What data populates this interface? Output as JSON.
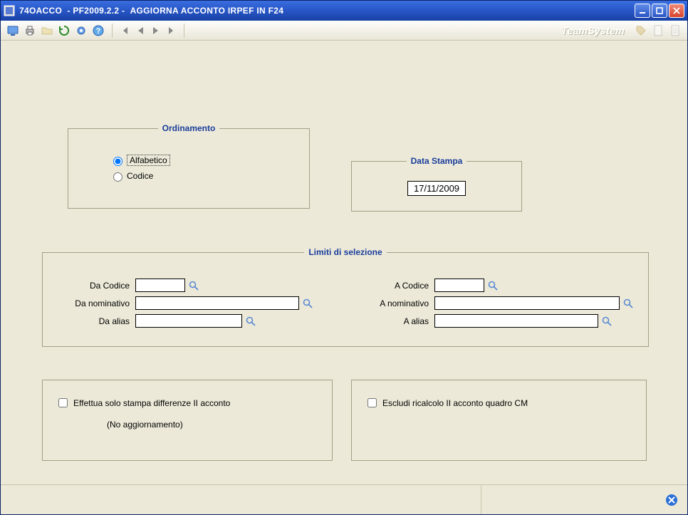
{
  "titlebar": {
    "app_code": "74OACCO",
    "version": "PF2009.2.2",
    "subtitle": "AGGIORNA ACCONTO IRPEF IN F24"
  },
  "brand": "TeamSystem",
  "groups": {
    "ordinamento_legend": "Ordinamento",
    "datastampa_legend": "Data Stampa",
    "limiti_legend": "Limiti di selezione"
  },
  "ordinamento": {
    "opt_alpha": "Alfabetico",
    "opt_code": "Codice",
    "selected": "alpha"
  },
  "stampa": {
    "date": "17/11/2009"
  },
  "limiti": {
    "da_codice_label": "Da Codice",
    "da_nominativo_label": "Da nominativo",
    "da_alias_label": "Da alias",
    "a_codice_label": "A Codice",
    "a_nominativo_label": "A nominativo",
    "a_alias_label": "A alias",
    "da_codice": "",
    "da_nominativo": "",
    "da_alias": "",
    "a_codice": "",
    "a_nominativo": "",
    "a_alias": ""
  },
  "options": {
    "solo_stampa_label": "Effettua solo stampa differenze II acconto",
    "solo_stampa_sub": "(No aggiornamento)",
    "escludi_label": "Escludi ricalcolo II acconto quadro CM",
    "solo_stampa_checked": false,
    "escludi_checked": false
  },
  "icons": {
    "magnifier": "lookup-icon"
  }
}
